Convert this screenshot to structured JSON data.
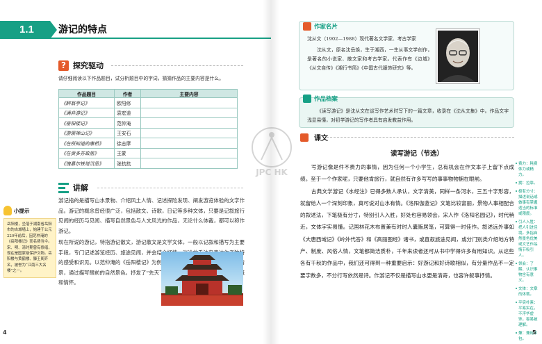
{
  "left": {
    "section_number": "1.1",
    "section_title": "游记的特点",
    "inquiry": {
      "heading": "探究驱动",
      "instruction": "请仔细阅读以下作品题目，试分析题目中的字词，猜猜作品的主要内容是什么。",
      "columns": [
        "作品题目",
        "作者",
        "主要内容"
      ],
      "rows": [
        {
          "title": "《醉翁亭记》",
          "author": "欧阳修"
        },
        {
          "title": "《满井游记》",
          "author": "袁宏道"
        },
        {
          "title": "《岳阳楼记》",
          "author": "范仲淹"
        },
        {
          "title": "《游褒禅山记》",
          "author": "王安石"
        },
        {
          "title": "《在所知道的康桥》",
          "author": "徐志摩"
        },
        {
          "title": "《在贡多芬故居》",
          "author": "王蒙"
        },
        {
          "title": "《瑰慕尔铁塔沉思》",
          "author": "张抗抗"
        }
      ]
    },
    "explain": {
      "heading": "讲解",
      "para1": "游记指的是描写山水景物、介绍风土人情、记述探险发现、阐发游览体验的文字作品。游记的概念曾经很广泛，包括散文、诗歌，日记等多种文体，只要是记叙旅行见闻的经历与见闻、描写自然景色与人文风光的作品，无论什么体裁，都可以称作游记。",
      "para2": "现在所说的游记，特指游记散文，游记散文是文学文体，一般以记叙和描写为主要手段，专门记述游览经历、旅途见闻，并会结合抒情、议论的手法来表达作者独特的感受和识见。以范仲淹的《岳阳楼记》为例，作品记叙了作者在岳阳楼观景的情景，通过描写眼前的自然景色，抒发了“先天下之忧而忧，后天下之乐而乐”的感慨和情怀。"
    },
    "tip": {
      "heading": "小提示",
      "text": "岳阳楼，坐落于湖南省岳阳市的古城墙上，始建于公元220年前后，因范仲淹的《岳阳楼记》而名扬当今。宋、明、清时期曾有修缮，现在是国家级保护文物。岳阳楼与黄鹤楼、滕王阁齐名，被誉为“江南三大名楼”之一。"
    },
    "page_number": "4"
  },
  "right": {
    "author_card": {
      "heading": "作家名片",
      "line1": "沈从文（1902—1988）现代著名文学家、考古学家",
      "line2": "沈从文，原名沈岳焕，生于湘西，一生从事文学创作，是著名的小说家、散文家和考古学家。代表作有《边城》《从文自传》《湘行书简》《中国古代服饰研究》等。"
    },
    "work_card": {
      "heading": "作品档案",
      "text": "《读写游记》是沈从文在谈写作艺术时写下的一篇文章，收录在《沈从文集》中。作品文字浅显易懂，对初学游记的写作者具有启发教益作用。"
    },
    "text_section": {
      "heading": "课文",
      "essay_title": "读写游记（节选）",
      "paragraphs": [
        "写游记像是件不费力的事情，因为任何一个小学生，总有机会在作文本子上留下点成绩。至于一个作家呢，只要他肯旅行，就自然有许多写写的事事物物拥在眼前。",
        "古典文学游记《水经注》已得多数人承认，文字清美，同样一条河水，三五十字形容，就留给人一个深刻印象，真可说对山水有情。《洛阳伽蓝记》文笔比较富丽，景物人事相配合的叙述法，下笔极有分寸，特别引人入胜，好处也容易领会，宋人作《洛阳名园记》，时代稍近，文体字实易懂。记国林花木布置兼有时时人囊贩居笔，可算得一时佳作。叙述远外事如《大唐西域记》《岭外代答》和《高丽图经》诸书，或直叙旅途见闻，或分门别类介绍地方特产、制度、风俗人情，文笔都简洁质朴，千年来读者还可从书中学得许多有用知识。从这些各有千秋的作品中，我们还可得到一种重要启示：好游记和好诗歌相似，有分量作品不一定要字数多，不分行写依然是诗。作游记不仅是描写山水更是清奇，也容许叙事抒情。"
      ]
    },
    "notes": [
      "费力：耗费体力或精力。",
      "拥：拉靠。",
      "极有分寸：描述说话或做事有掌握适当的标准或限度。",
      "引人入胜：把人引进佳境。多指自然景色优美或文艺作品情节吸引人。",
      "领会：了解、认识事物含有意义。",
      "文体：文章的体裁。",
      "平实朴素：平易实在，不浮华虚饰，容易被理解。",
      "兼：兼用中包。"
    ],
    "page_number": "5"
  },
  "watermark": "JPC HK"
}
